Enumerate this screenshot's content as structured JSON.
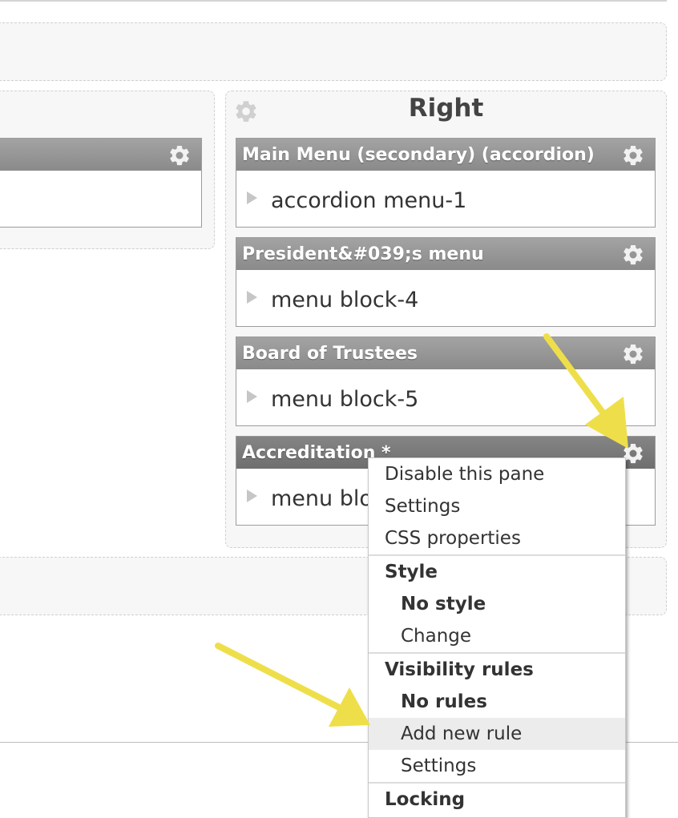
{
  "regions": {
    "right_title": "Right"
  },
  "panes": [
    {
      "title": "Main Menu (secondary) (accordion)",
      "content": "accordion menu-1"
    },
    {
      "title": "President&#039;s menu",
      "content": "menu block-4"
    },
    {
      "title": "Board of Trustees",
      "content": "menu block-5"
    },
    {
      "title": "Accreditation *",
      "content": "menu block-6"
    }
  ],
  "context_menu": {
    "disable": "Disable this pane",
    "settings": "Settings",
    "css": "CSS properties",
    "style_heading": "Style",
    "no_style": "No style",
    "change": "Change",
    "visibility_heading": "Visibility rules",
    "no_rules": "No rules",
    "add_rule": "Add new rule",
    "vis_settings": "Settings",
    "locking_heading": "Locking"
  },
  "colors": {
    "annotation_arrow": "#eedf4a",
    "pane_header": "#8a8a8a",
    "active_pane_header": "#6e6e6e",
    "menu_highlight": "#ececec"
  },
  "icons": {
    "pane_settings": "gear-icon",
    "content_marker": "triangle-right-icon"
  }
}
